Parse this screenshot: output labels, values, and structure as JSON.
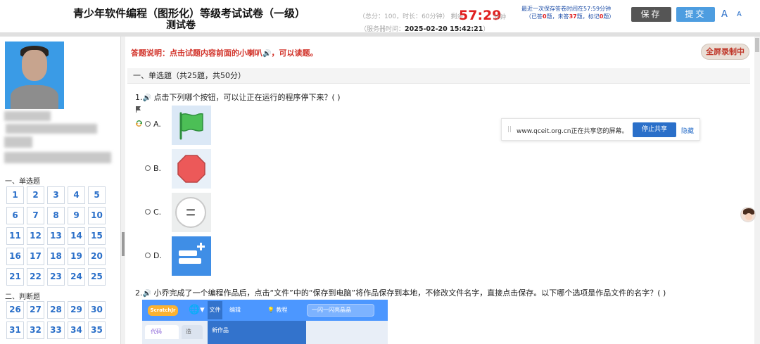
{
  "header": {
    "title_line1": "青少年软件编程（图形化）等级考试试卷（一级）",
    "title_line2": "测试卷",
    "total_score": "（总分：100，时长：60分钟）",
    "remaining_label": "剩余",
    "timer": "57:29",
    "timer_unit": "分钟",
    "server_time_label": "（服务器时间：",
    "server_time": "2025-02-20 15:42:21",
    "server_time_close": "）",
    "save_info_line1": "最近一次保存答卷时间在57:59分钟",
    "save_info_prefix": "（已答",
    "answered": "0",
    "save_info_mid1": "题，未答",
    "unanswered": "37",
    "save_info_mid2": "题，标记",
    "marked": "0",
    "save_info_suffix": "题）",
    "save_label": "保存",
    "submit_label": "提交",
    "font_large": "A",
    "font_small": "A"
  },
  "sidebar": {
    "section_single": "一、单选题",
    "single_numbers": [
      "1",
      "2",
      "3",
      "4",
      "5",
      "6",
      "7",
      "8",
      "9",
      "10",
      "11",
      "12",
      "13",
      "14",
      "15",
      "16",
      "17",
      "18",
      "19",
      "20",
      "21",
      "22",
      "23",
      "24",
      "25"
    ],
    "section_judge": "二、判断题",
    "judge_numbers": [
      "26",
      "27",
      "28",
      "29",
      "30",
      "31",
      "32",
      "33",
      "34",
      "35"
    ]
  },
  "main": {
    "instruction": "答题说明：点击试题内容前面的小喇叭",
    "instruction_suffix": "，可以读题。",
    "fullscreen_recording": "全屏录制中",
    "section_title": "一、单选题（共25题，共50分）",
    "q1_number": "1.",
    "q1_text": "点击下列哪个按钮，可以让正在运行的程序停下来？(    )",
    "options": [
      "A.",
      "B.",
      "C.",
      "D."
    ],
    "q2_number": "2.",
    "q2_text": "小乔完成了一个编程作品后，点击“文件”中的“保存到电脑”将作品保存到本地，不修改文件名字，直接点击保存。以下哪个选项是作品文件的名字？(    )"
  },
  "share_bar": {
    "grip": "||",
    "text": "www.qceit.org.cn正在共享您的屏幕。",
    "stop_label": "停止共享",
    "hide_label": "隐藏"
  },
  "scratch": {
    "logo": "ScratchJr",
    "file_menu": "文件",
    "edit_menu": "编辑",
    "tutorial_menu": "教程",
    "project_title": "一闪一闪亮晶晶",
    "new_project": "新作品",
    "tab_code": "代码",
    "tab_other": "造"
  },
  "colors": {
    "accent_blue": "#2a6fc9",
    "timer_red": "#e02020",
    "instruction_red": "#d2342b",
    "green_flag": "#4cbf56",
    "stop_red": "#ec5959",
    "scratch_blue": "#4c97ff"
  }
}
